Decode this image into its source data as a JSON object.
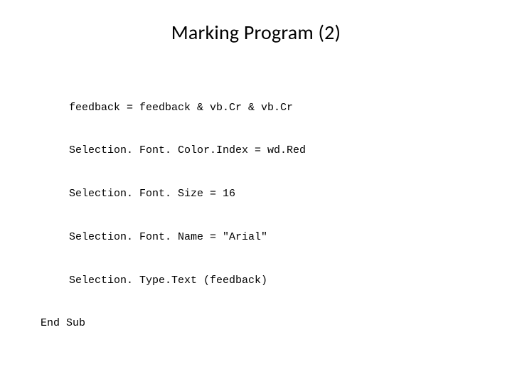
{
  "slide": {
    "title": "Marking Program (2)",
    "code": {
      "line1": "feedback = feedback & vb.Cr & vb.Cr",
      "line2": "Selection. Font. Color.Index = wd.Red",
      "line3": "Selection. Font. Size = 16",
      "line4": "Selection. Font. Name = \"Arial\"",
      "line5": "Selection. Type.Text (feedback)",
      "line6": "End Sub"
    }
  }
}
